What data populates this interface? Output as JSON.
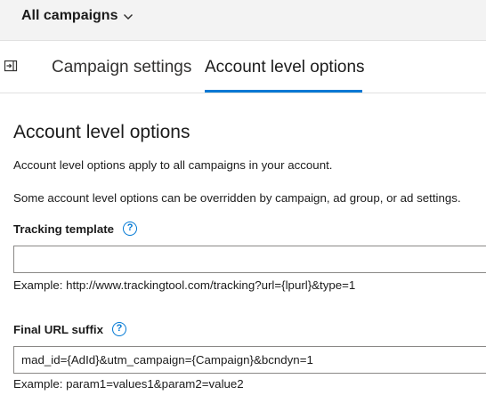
{
  "header": {
    "campaign_picker_label": "All campaigns"
  },
  "tabs": {
    "campaign_settings": "Campaign settings",
    "account_level_options": "Account level options",
    "active": "account_level_options"
  },
  "page": {
    "title": "Account level options",
    "description_1": "Account level options apply to all campaigns in your account.",
    "description_2": "Some account level options can be overridden by campaign, ad group, or ad settings."
  },
  "tracking_template": {
    "label": "Tracking template",
    "value": "",
    "example": "Example: http://www.trackingtool.com/tracking?url={lpurl}&type=1"
  },
  "final_url_suffix": {
    "label": "Final URL suffix",
    "value": "mad_id={AdId}&utm_campaign={Campaign}&bcndyn=1",
    "example": "Example: param1=values1&param2=value2"
  },
  "icons": {
    "help": "?",
    "collapse": "collapse-panel-icon",
    "dropdown": "chevron-down-icon"
  },
  "colors": {
    "accent": "#0078d4",
    "topbar_bg": "#f3f3f3",
    "input_border": "#8a8886"
  }
}
